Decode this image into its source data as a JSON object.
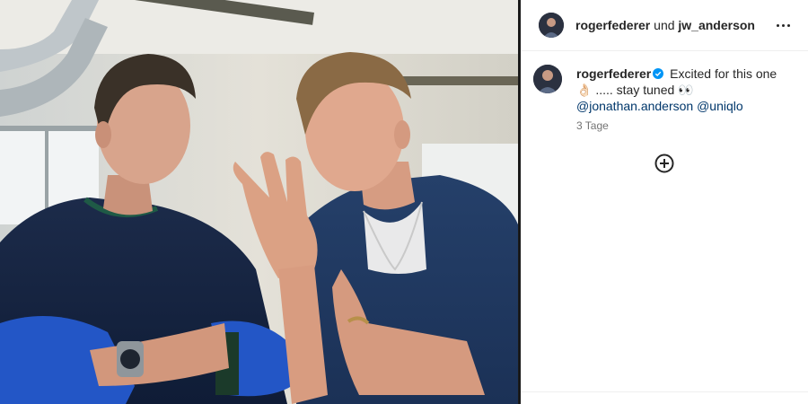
{
  "post": {
    "author": "rogerfederer",
    "collab_connector": "und",
    "collaborator": "jw_anderson"
  },
  "caption": {
    "username": "rogerfederer",
    "text_line1": "Excited for this one",
    "emoji1": "👌🏻",
    "text_line2": "..... stay tuned",
    "emoji2": "👀",
    "mention1": "@jonathan.anderson",
    "mention2": "@uniqlo"
  },
  "time": "3 Tage",
  "icons": {
    "more": "more-horizontal-icon",
    "verified": "verified-badge-icon",
    "load_more": "plus-circle-icon"
  },
  "colors": {
    "verified": "#0095f6",
    "link": "#00376b",
    "muted": "#737373"
  }
}
